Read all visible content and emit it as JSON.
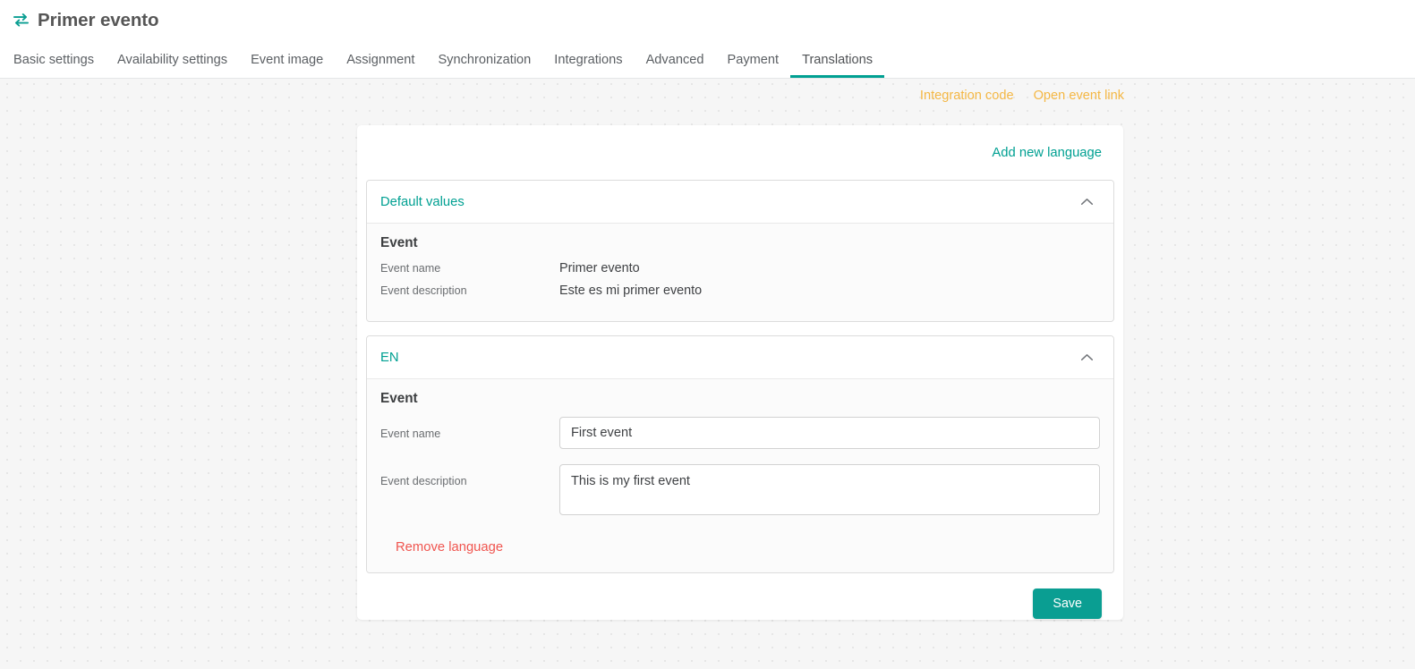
{
  "header": {
    "icon": "swap-arrows-icon",
    "title": "Primer evento",
    "accent_color": "#00a092"
  },
  "tabs": [
    {
      "label": "Basic settings",
      "active": false
    },
    {
      "label": "Availability settings",
      "active": false
    },
    {
      "label": "Event image",
      "active": false
    },
    {
      "label": "Assignment",
      "active": false
    },
    {
      "label": "Synchronization",
      "active": false
    },
    {
      "label": "Integrations",
      "active": false
    },
    {
      "label": "Advanced",
      "active": false
    },
    {
      "label": "Payment",
      "active": false
    },
    {
      "label": "Translations",
      "active": true
    }
  ],
  "util_links": [
    {
      "label": "Integration code",
      "color": "#f4b744"
    },
    {
      "label": "Open event link",
      "color": "#f4b744"
    }
  ],
  "card": {
    "add_language_label": "Add new language"
  },
  "panels": [
    {
      "key": "default",
      "title": "Default values",
      "collapse_icon": "chevron-up-icon",
      "section_title": "Event",
      "readonly_rows": [
        {
          "label": "Event name",
          "value": "Primer evento"
        },
        {
          "label": "Event description",
          "value": "Este es mi primer evento"
        }
      ]
    },
    {
      "key": "en",
      "title": "EN",
      "collapse_icon": "chevron-up-icon",
      "section_title": "Event",
      "fields": [
        {
          "label": "Event name",
          "value": "First event",
          "placeholder": "",
          "type": "input"
        },
        {
          "label": "Event description",
          "value": "This is my first event",
          "placeholder": "",
          "type": "textarea"
        }
      ],
      "remove_label": "Remove language",
      "remove_color": "#f0554f"
    }
  ],
  "footer": {
    "save_label": "Save",
    "save_color": "#0a9e92"
  }
}
